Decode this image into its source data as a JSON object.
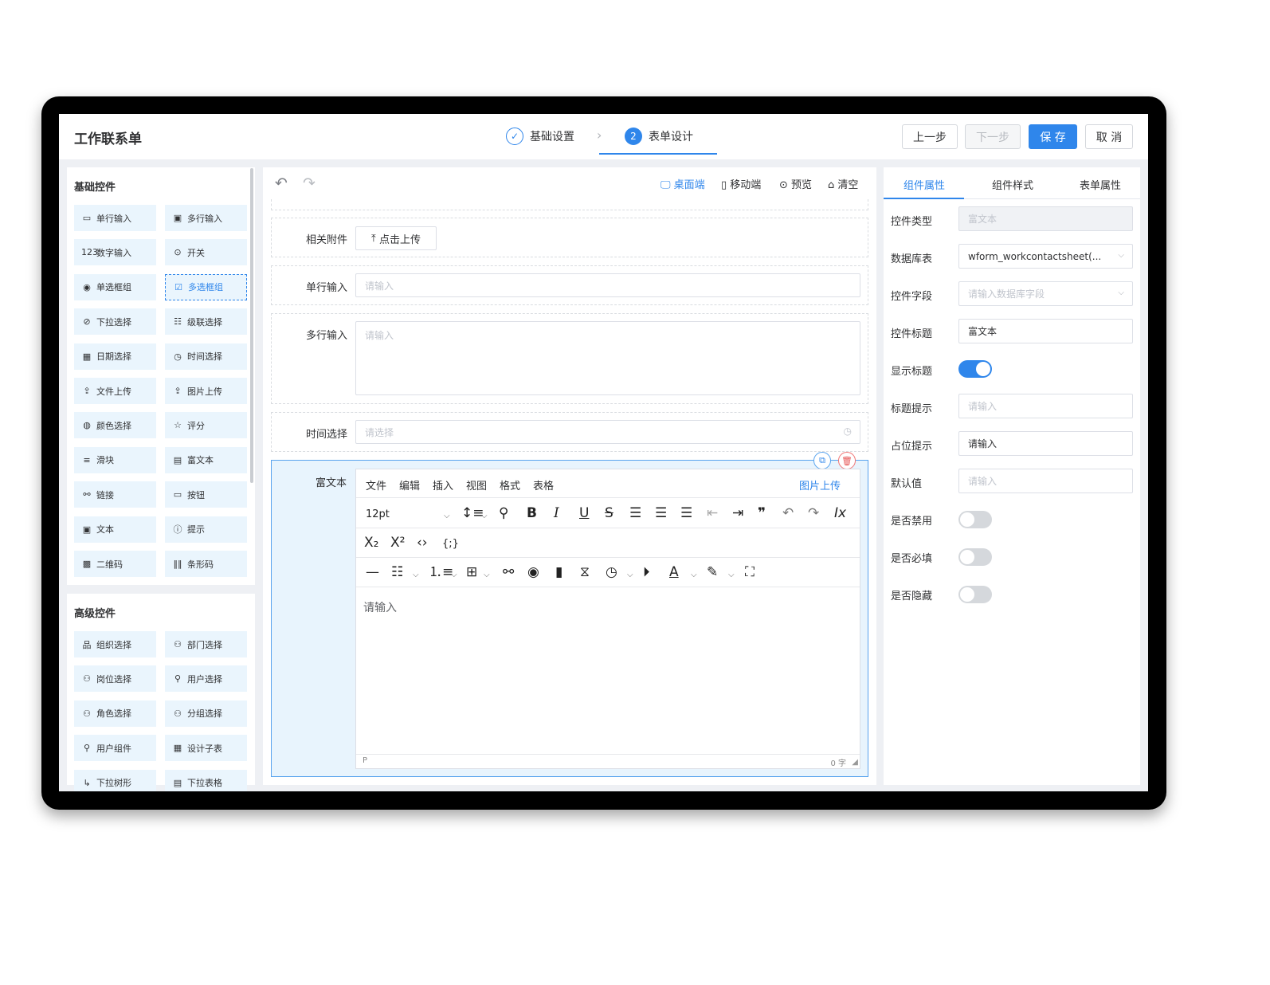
{
  "app_title": "工作联系单",
  "steps": [
    {
      "num": "✓",
      "label": "基础设置"
    },
    {
      "num": "2",
      "label": "表单设计"
    }
  ],
  "step_separator": "›",
  "actions": {
    "prev": "上一步",
    "next": "下一步",
    "save": "保 存",
    "cancel": "取 消"
  },
  "basic_controls": {
    "title": "基础控件",
    "items": [
      {
        "icon": "▭",
        "label": "单行输入"
      },
      {
        "icon": "▣",
        "label": "多行输入"
      },
      {
        "icon": "123",
        "label": "数字输入"
      },
      {
        "icon": "⊙",
        "label": "开关"
      },
      {
        "icon": "◉",
        "label": "单选框组"
      },
      {
        "icon": "☑",
        "label": "多选框组"
      },
      {
        "icon": "⊘",
        "label": "下拉选择"
      },
      {
        "icon": "☷",
        "label": "级联选择"
      },
      {
        "icon": "▦",
        "label": "日期选择"
      },
      {
        "icon": "◷",
        "label": "时间选择"
      },
      {
        "icon": "⇪",
        "label": "文件上传"
      },
      {
        "icon": "⇪",
        "label": "图片上传"
      },
      {
        "icon": "◍",
        "label": "颜色选择"
      },
      {
        "icon": "☆",
        "label": "评分"
      },
      {
        "icon": "≡",
        "label": "滑块"
      },
      {
        "icon": "▤",
        "label": "富文本"
      },
      {
        "icon": "⚯",
        "label": "链接"
      },
      {
        "icon": "▭",
        "label": "按钮"
      },
      {
        "icon": "▣",
        "label": "文本"
      },
      {
        "icon": "ⓘ",
        "label": "提示"
      },
      {
        "icon": "▩",
        "label": "二维码"
      },
      {
        "icon": "‖‖",
        "label": "条形码"
      }
    ]
  },
  "advanced_controls": {
    "title": "高级控件",
    "items": [
      {
        "icon": "品",
        "label": "组织选择"
      },
      {
        "icon": "⚇",
        "label": "部门选择"
      },
      {
        "icon": "⚇",
        "label": "岗位选择"
      },
      {
        "icon": "⚲",
        "label": "用户选择"
      },
      {
        "icon": "⚇",
        "label": "角色选择"
      },
      {
        "icon": "⚇",
        "label": "分组选择"
      },
      {
        "icon": "⚲",
        "label": "用户组件"
      },
      {
        "icon": "▦",
        "label": "设计子表"
      },
      {
        "icon": "↳",
        "label": "下拉树形"
      },
      {
        "icon": "▤",
        "label": "下拉表格"
      }
    ]
  },
  "canvas_toolbar": {
    "undo": "↶",
    "redo": "↷",
    "desktop": "桌面端",
    "mobile": "移动端",
    "preview": "预览",
    "clear": "清空"
  },
  "form_fields": {
    "attachment": {
      "label": "相关附件",
      "button": "点击上传"
    },
    "single_line": {
      "label": "单行输入",
      "placeholder": "请输入"
    },
    "multi_line": {
      "label": "多行输入",
      "placeholder": "请输入"
    },
    "time": {
      "label": "时间选择",
      "placeholder": "请选择"
    },
    "rich_text": {
      "label": "富文本"
    }
  },
  "editor": {
    "menus": [
      "文件",
      "编辑",
      "插入",
      "视图",
      "格式",
      "表格"
    ],
    "image_upload": "图片上传",
    "font_size": "12pt",
    "placeholder": "请输入",
    "status_path": "P",
    "word_count": "0 字"
  },
  "props_tabs": [
    "组件属性",
    "组件样式",
    "表单属性"
  ],
  "props": {
    "type": {
      "label": "控件类型",
      "value": "富文本"
    },
    "table": {
      "label": "数据库表",
      "value": "wform_workcontactsheet(..."
    },
    "field": {
      "label": "控件字段",
      "placeholder": "请输入数据库字段"
    },
    "title": {
      "label": "控件标题",
      "value": "富文本"
    },
    "show_title": {
      "label": "显示标题",
      "on": true
    },
    "title_tip": {
      "label": "标题提示",
      "placeholder": "请输入"
    },
    "placeholder": {
      "label": "占位提示",
      "value": "请输入"
    },
    "default": {
      "label": "默认值",
      "placeholder": "请输入"
    },
    "disabled": {
      "label": "是否禁用",
      "on": false
    },
    "required": {
      "label": "是否必填",
      "on": false
    },
    "hidden": {
      "label": "是否隐藏",
      "on": false
    }
  },
  "colors": {
    "accent": "#2f86eb",
    "panel_bg": "#eef0f4",
    "control_bg": "#eaf5fd",
    "delete": "#e65555"
  }
}
